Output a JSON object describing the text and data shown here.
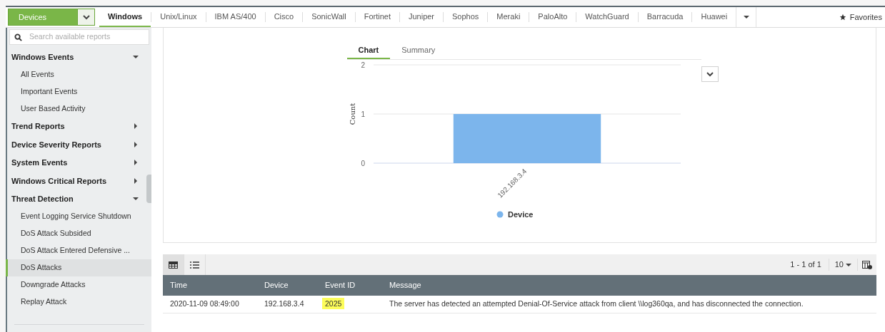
{
  "device_selector": {
    "label": "Devices"
  },
  "vendor_tabs": [
    {
      "label": "Windows",
      "selected": true
    },
    {
      "label": "Unix/Linux",
      "selected": false
    },
    {
      "label": "IBM AS/400",
      "selected": false
    },
    {
      "label": "Cisco",
      "selected": false
    },
    {
      "label": "SonicWall",
      "selected": false
    },
    {
      "label": "Fortinet",
      "selected": false
    },
    {
      "label": "Juniper",
      "selected": false
    },
    {
      "label": "Sophos",
      "selected": false
    },
    {
      "label": "Meraki",
      "selected": false
    },
    {
      "label": "PaloAlto",
      "selected": false
    },
    {
      "label": "WatchGuard",
      "selected": false
    },
    {
      "label": "Barracuda",
      "selected": false
    },
    {
      "label": "Huawei",
      "selected": false
    }
  ],
  "favorites": {
    "label": "Favorites"
  },
  "sidebar": {
    "search": {
      "placeholder": "Search available reports"
    },
    "groups": [
      {
        "label": "Windows Events",
        "expanded": true,
        "children": [
          {
            "label": "All Events",
            "selected": false
          },
          {
            "label": "Important Events",
            "selected": false
          },
          {
            "label": "User Based Activity",
            "selected": false
          }
        ]
      },
      {
        "label": "Trend Reports",
        "expanded": false
      },
      {
        "label": "Device Severity Reports",
        "expanded": false
      },
      {
        "label": "System Events",
        "expanded": false
      },
      {
        "label": "Windows Critical Reports",
        "expanded": false
      },
      {
        "label": "Threat Detection",
        "expanded": true,
        "children": [
          {
            "label": "Event Logging Service Shutdown",
            "selected": false
          },
          {
            "label": "DoS Attack Subsided",
            "selected": false
          },
          {
            "label": "DoS Attack Entered Defensive ...",
            "selected": false
          },
          {
            "label": "DoS Attacks",
            "selected": true
          },
          {
            "label": "Downgrade Attacks",
            "selected": false
          },
          {
            "label": "Replay Attack",
            "selected": false
          }
        ]
      }
    ]
  },
  "view_tabs": [
    {
      "label": "Chart",
      "selected": true
    },
    {
      "label": "Summary",
      "selected": false
    }
  ],
  "chart_data": {
    "type": "bar",
    "ylabel": "Count",
    "categories": [
      "192.168.3.4"
    ],
    "series": [
      {
        "name": "Device",
        "color": "#7cb5ec",
        "values": [
          1
        ]
      }
    ],
    "ylim": [
      0,
      2
    ],
    "yticks": [
      0,
      1,
      2
    ]
  },
  "table": {
    "view_modes": [
      {
        "kind": "grid",
        "selected": true
      },
      {
        "kind": "list",
        "selected": false
      }
    ],
    "pagination": "1 - 1 of 1",
    "page_size": "10",
    "columns": [
      "Time",
      "Device",
      "Event ID",
      "Message"
    ],
    "rows": [
      [
        {
          "text": "2020-11-09 08:49:00",
          "highlighted": false
        },
        {
          "text": "192.168.3.4",
          "highlighted": false
        },
        {
          "text": "2025",
          "highlighted": true
        },
        {
          "text": "The server has detected an attempted Denial-Of-Service attack from client \\\\log360qa, and has disconnected the connection.",
          "highlighted": false
        }
      ]
    ]
  }
}
